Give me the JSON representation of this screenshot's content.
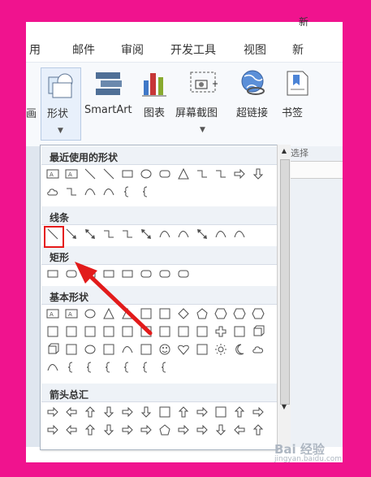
{
  "title_fragment": "新",
  "menu": {
    "items": [
      "用",
      "邮件",
      "审阅",
      "开发工具",
      "视图",
      "新"
    ]
  },
  "ribbon": {
    "shape_label": "形状",
    "smartart_label": "SmartArt",
    "chart_label": "图表",
    "screenshot_label": "屏幕截图",
    "hyperlink_label": "超链接",
    "bookmark_label": "书签",
    "left_fragment": "画",
    "select_fragment": "选择"
  },
  "gallery": {
    "recent_title": "最近使用的形状",
    "lines_title": "线条",
    "rect_title": "矩形",
    "basic_title": "基本形状",
    "arrows_title": "箭头总汇"
  },
  "icons": {
    "recent_row1": [
      "text-box-icon",
      "vertical-text-box-icon",
      "line-icon",
      "arrow-line-icon",
      "rectangle-icon",
      "ellipse-icon",
      "rounded-rectangle-icon",
      "triangle-icon",
      "elbow-connector-icon",
      "elbow-connector-arrow-icon",
      "right-arrow-icon",
      "down-arrow-icon"
    ],
    "recent_row2": [
      "cloud-icon",
      "curved-connector-icon",
      "arc-icon",
      "freeform-icon",
      "left-brace-icon",
      "right-brace-icon"
    ],
    "line_icons": [
      "straight-line-icon",
      "arrow-icon",
      "double-arrow-icon",
      "elbow-icon",
      "elbow-arrow-icon",
      "elbow-double-arrow-icon",
      "curve-icon",
      "curve-arrow-icon",
      "curve-double-arrow-icon",
      "freeform-icon",
      "scribble-icon"
    ],
    "rect_icons": [
      "rectangle-icon",
      "rounded-rect-icon",
      "snip-rect-icon",
      "snip-same-side-rect-icon",
      "snip-diagonal-rect-icon",
      "round-single-corner-rect-icon",
      "round-same-side-rect-icon",
      "round-diagonal-rect-icon"
    ],
    "basic_row1": [
      "text-box-icon",
      "vertical-text-box-icon",
      "ellipse-icon",
      "triangle-icon",
      "right-triangle-icon",
      "parallelogram-icon",
      "trapezoid-icon",
      "diamond-icon",
      "pentagon-icon",
      "hexagon-icon",
      "heptagon-icon",
      "octagon-icon"
    ],
    "basic_row2": [
      "decagon-icon",
      "dodecagon-icon",
      "pie-icon",
      "chord-icon",
      "teardrop-icon",
      "frame-icon",
      "half-frame-icon",
      "l-shape-icon",
      "diagonal-stripe-icon",
      "cross-icon",
      "plaque-icon",
      "can-icon"
    ],
    "basic_row3": [
      "cube-icon",
      "bevel-icon",
      "donut-icon",
      "no-symbol-icon",
      "block-arc-icon",
      "folded-corner-icon",
      "smiley-icon",
      "heart-icon",
      "lightning-icon",
      "sun-icon",
      "moon-icon",
      "cloud-icon"
    ],
    "basic_row4": [
      "arc-icon",
      "double-bracket-icon",
      "double-brace-icon",
      "left-bracket-icon",
      "right-bracket-icon",
      "left-brace-icon",
      "right-brace-icon"
    ],
    "arrow_row1": [
      "right-arrow-icon",
      "left-arrow-icon",
      "up-arrow-icon",
      "down-arrow-icon",
      "left-right-arrow-icon",
      "up-down-arrow-icon",
      "quad-arrow-icon",
      "left-right-up-arrow-icon",
      "bent-arrow-icon",
      "u-turn-arrow-icon",
      "left-up-arrow-icon",
      "bent-up-arrow-icon"
    ],
    "arrow_row2": [
      "curved-right-arrow-icon",
      "curved-left-arrow-icon",
      "curved-up-arrow-icon",
      "curved-down-arrow-icon",
      "striped-right-arrow-icon",
      "notched-right-arrow-icon",
      "pentagon-arrow-icon",
      "chevron-icon",
      "right-arrow-callout-icon",
      "down-arrow-callout-icon",
      "left-arrow-callout-icon",
      "up-arrow-callout-icon"
    ]
  },
  "watermark": {
    "brand": "Bai 经验",
    "url": "jingyan.baidu.com"
  }
}
